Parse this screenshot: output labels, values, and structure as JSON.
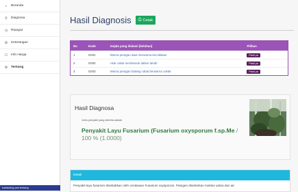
{
  "sidebar": {
    "items": [
      {
        "icon": "home-icon",
        "label": "Beranda"
      },
      {
        "icon": "search-icon",
        "label": "Diagnosa"
      },
      {
        "icon": "history-icon",
        "label": "Riwayat"
      },
      {
        "icon": "info-icon",
        "label": "Keterangan"
      },
      {
        "icon": "price-icon",
        "label": "Info Harga"
      },
      {
        "icon": "about-icon",
        "label": "Tentang"
      }
    ],
    "footer": "kuetaoting pea tentang"
  },
  "header": {
    "title": "Hasil Diagnosis",
    "print_label": "Cetak"
  },
  "table": {
    "headers": [
      "No",
      "Kode",
      "Gejala yang dialami (keluhan)",
      "Pilihan"
    ],
    "rows": [
      {
        "no": "1",
        "kode": "G001",
        "gejala": "Warna peragan daun berwarna kecoklatan",
        "pilihan": "Pasti ya"
      },
      {
        "no": "2",
        "kode": "G002",
        "gejala": "Akar cabai membusuk dalam tanah",
        "pilihan": "Pasti ya"
      },
      {
        "no": "3",
        "kode": "G003",
        "gejala": "Warna peragan batang cabai berwarna coklat",
        "pilihan": "Pasti ya"
      }
    ]
  },
  "result": {
    "title": "Hasil Diagnosa",
    "note": "Jenis penyakit yang diderita adalah",
    "disease": "Penyakit Layu Fusarium (Fusarium oxysporum f.sp.Me",
    "percentage": "/ 100 % (1.0000)"
  },
  "detail": {
    "header": "Detail",
    "text": "Penyakit layu fusarium disebabkan oleh cendawan Fusarium oxysporum. Patogen disebarkan melalui udara dan air."
  },
  "colors": {
    "table_header": "#9b54b8",
    "badge": "#5a1f5c",
    "print_button": "#1aa75e",
    "detail_header": "#1fb8dc",
    "disease_text": "#2f7a3c"
  }
}
